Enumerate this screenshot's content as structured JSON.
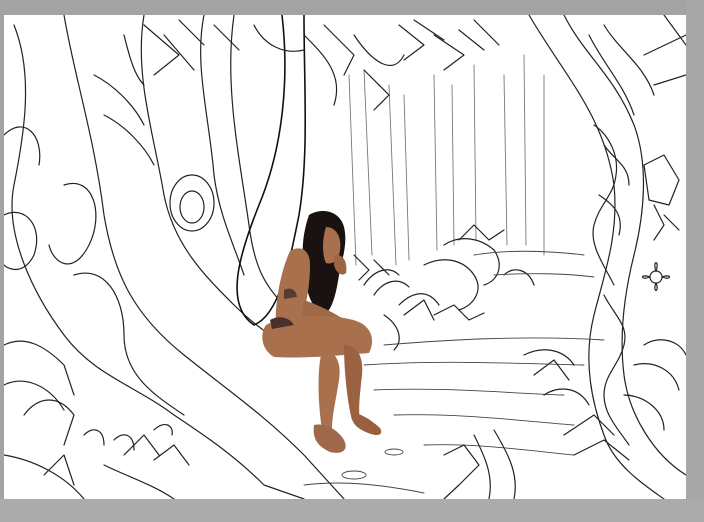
{
  "app": {
    "workspace_color": "#a3a3a3",
    "canvas_color": "#ffffff"
  },
  "artwork": {
    "kind": "line-art jungle scene with photo cut-out",
    "ink_color": "#1f1f1f",
    "skin_color": "#a8704d",
    "hair_color": "#1a1210",
    "icons": [
      "tree-trunk",
      "vine",
      "fern",
      "flower",
      "path"
    ]
  }
}
